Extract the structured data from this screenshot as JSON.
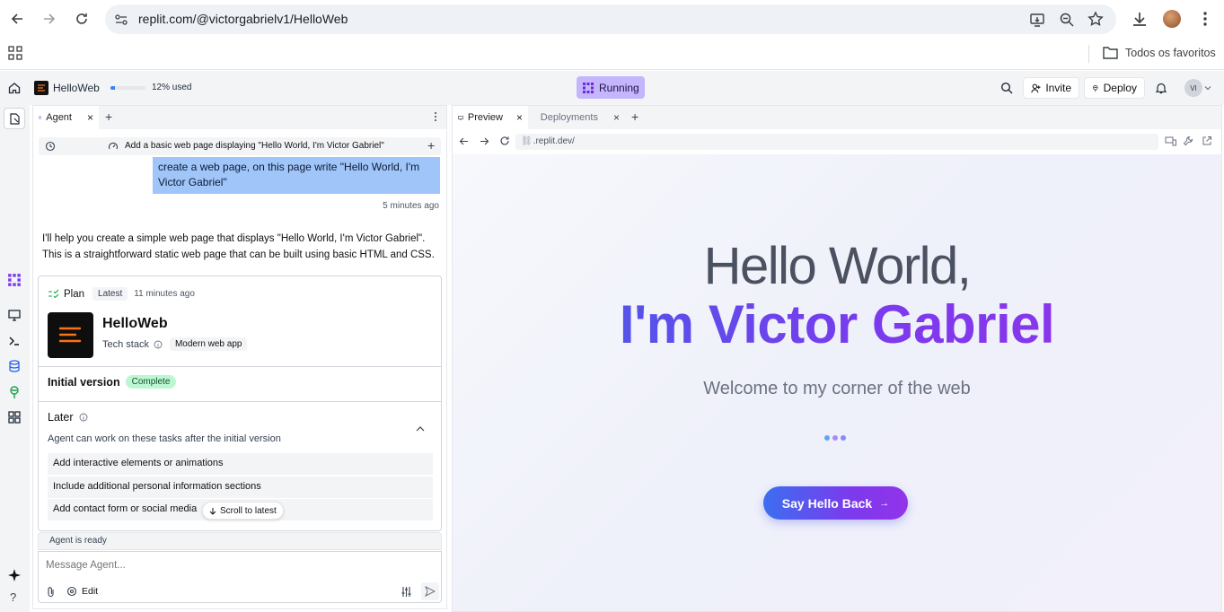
{
  "browser": {
    "url": "replit.com/@victorgabrielv1/HelloWeb",
    "bookmarks_folder": "Todos os favoritos"
  },
  "replit_bar": {
    "project_name": "HelloWeb",
    "usage_label": "12% used",
    "usage_fraction": 0.12,
    "status": "Running",
    "invite_label": "Invite",
    "deploy_label": "Deploy",
    "avatar_initials": "VI"
  },
  "agent": {
    "tab_label": "Agent",
    "task_title": "Add a basic web page displaying \"Hello World, I'm Victor Gabriel\"",
    "user_message": "create a web page, on this page write \"Hello World, I'm Victor Gabriel\"",
    "message_time": "5 minutes ago",
    "reply_line1": "I'll help you create a simple web page that displays \"Hello World, I'm Victor Gabriel\".",
    "reply_line2": "This is a straightforward static web page that can be built using basic HTML and CSS.",
    "plan": {
      "label": "Plan",
      "badge": "Latest",
      "time": "11 minutes ago",
      "app_name": "HelloWeb",
      "tech_stack_label": "Tech stack",
      "tech_stack_value": "Modern web app",
      "initial_version_label": "Initial version",
      "initial_version_status": "Complete",
      "later_label": "Later",
      "later_description": "Agent can work on these tasks after the initial version",
      "later_tasks": [
        "Add interactive elements or animations",
        "Include additional personal information sections",
        "Add contact form or social media"
      ]
    },
    "scroll_latest": "Scroll to latest",
    "status": "Agent is ready",
    "input_placeholder": "Message Agent...",
    "edit_label": "Edit"
  },
  "preview": {
    "tab_preview": "Preview",
    "tab_deployments": "Deployments",
    "url": ".replit.dev/",
    "heading_line1": "Hello World,",
    "heading_line2": "I'm Victor Gabriel",
    "subtitle": "Welcome to my corner of the web",
    "button_label": "Say Hello Back"
  },
  "colors": {
    "accent_purple": "#7c3aed",
    "accent_blue": "#3b63e8",
    "running_bg": "#c4b5fd",
    "complete_green": "#bbf7d0",
    "user_bubble": "#a0c5f8"
  }
}
